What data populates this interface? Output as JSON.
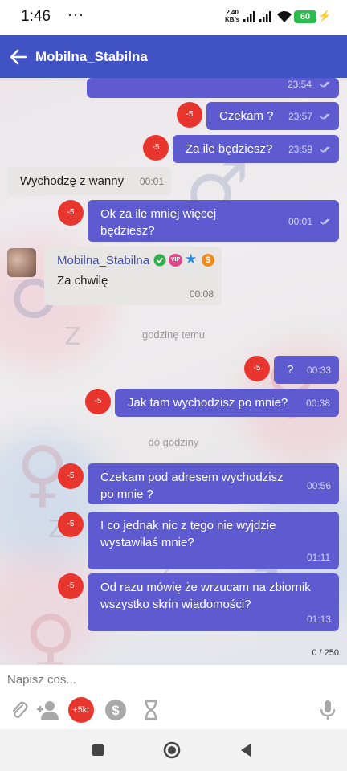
{
  "status_bar": {
    "time": "1:46",
    "dots": "···",
    "net_speed_value": "2,40",
    "net_speed_unit": "KB/s",
    "battery": "60"
  },
  "header": {
    "title": "Mobilna_Stabilna"
  },
  "messages": [
    {
      "time": "23:54"
    },
    {
      "text": "Czekam ?",
      "time": "23:57",
      "badge": "-5"
    },
    {
      "text": "Za ile będziesz?",
      "time": "23:59",
      "badge": "-5"
    },
    {
      "text": "Wychodzę z wanny",
      "time": "00:01"
    },
    {
      "line1": "Ok za ile mniej więcej",
      "line2": "będziesz?",
      "time": "00:01",
      "badge": "-5"
    },
    {
      "sender": "Mobilna_Stabilna",
      "text": "Za chwilę",
      "time": "00:08",
      "vip": "VIP",
      "dollar": "$"
    },
    {
      "text": "?",
      "time": "00:33",
      "badge": "-5"
    },
    {
      "text": "Jak tam wychodzisz po mnie?",
      "time": "00:38",
      "badge": "-5"
    },
    {
      "line1": "Czekam pod adresem wychodzisz",
      "line2": "po mnie ?",
      "time": "00:56",
      "badge": "-5"
    },
    {
      "line1": "I co jednak nic z tego nie wyjdzie",
      "line2": "wystawiłaś mnie?",
      "time": "01:11",
      "badge": "-5"
    },
    {
      "line1": "Od razu mówię że wrzucam na zbiornik",
      "line2": "wszystko skrin wiadomości?",
      "time": "01:13",
      "badge": "-5"
    }
  ],
  "dividers": [
    "godzinę temu",
    "do godziny"
  ],
  "composer": {
    "char_counter": "0 / 250",
    "placeholder": "Napisz coś...",
    "tip_label": "+5kr"
  },
  "colors": {
    "app_bar": "#4052c4",
    "bubble_out": "#5e5bd1",
    "bubble_in": "#e8e5e5",
    "badge": "#e8362f"
  },
  "icons": [
    "back-arrow-icon",
    "double-check-icon",
    "verified-icon",
    "star-icon",
    "attach-icon",
    "add-user-icon",
    "dollar-icon",
    "hourglass-icon",
    "microphone-icon",
    "nav-square-icon",
    "nav-circle-icon",
    "nav-triangle-icon"
  ]
}
